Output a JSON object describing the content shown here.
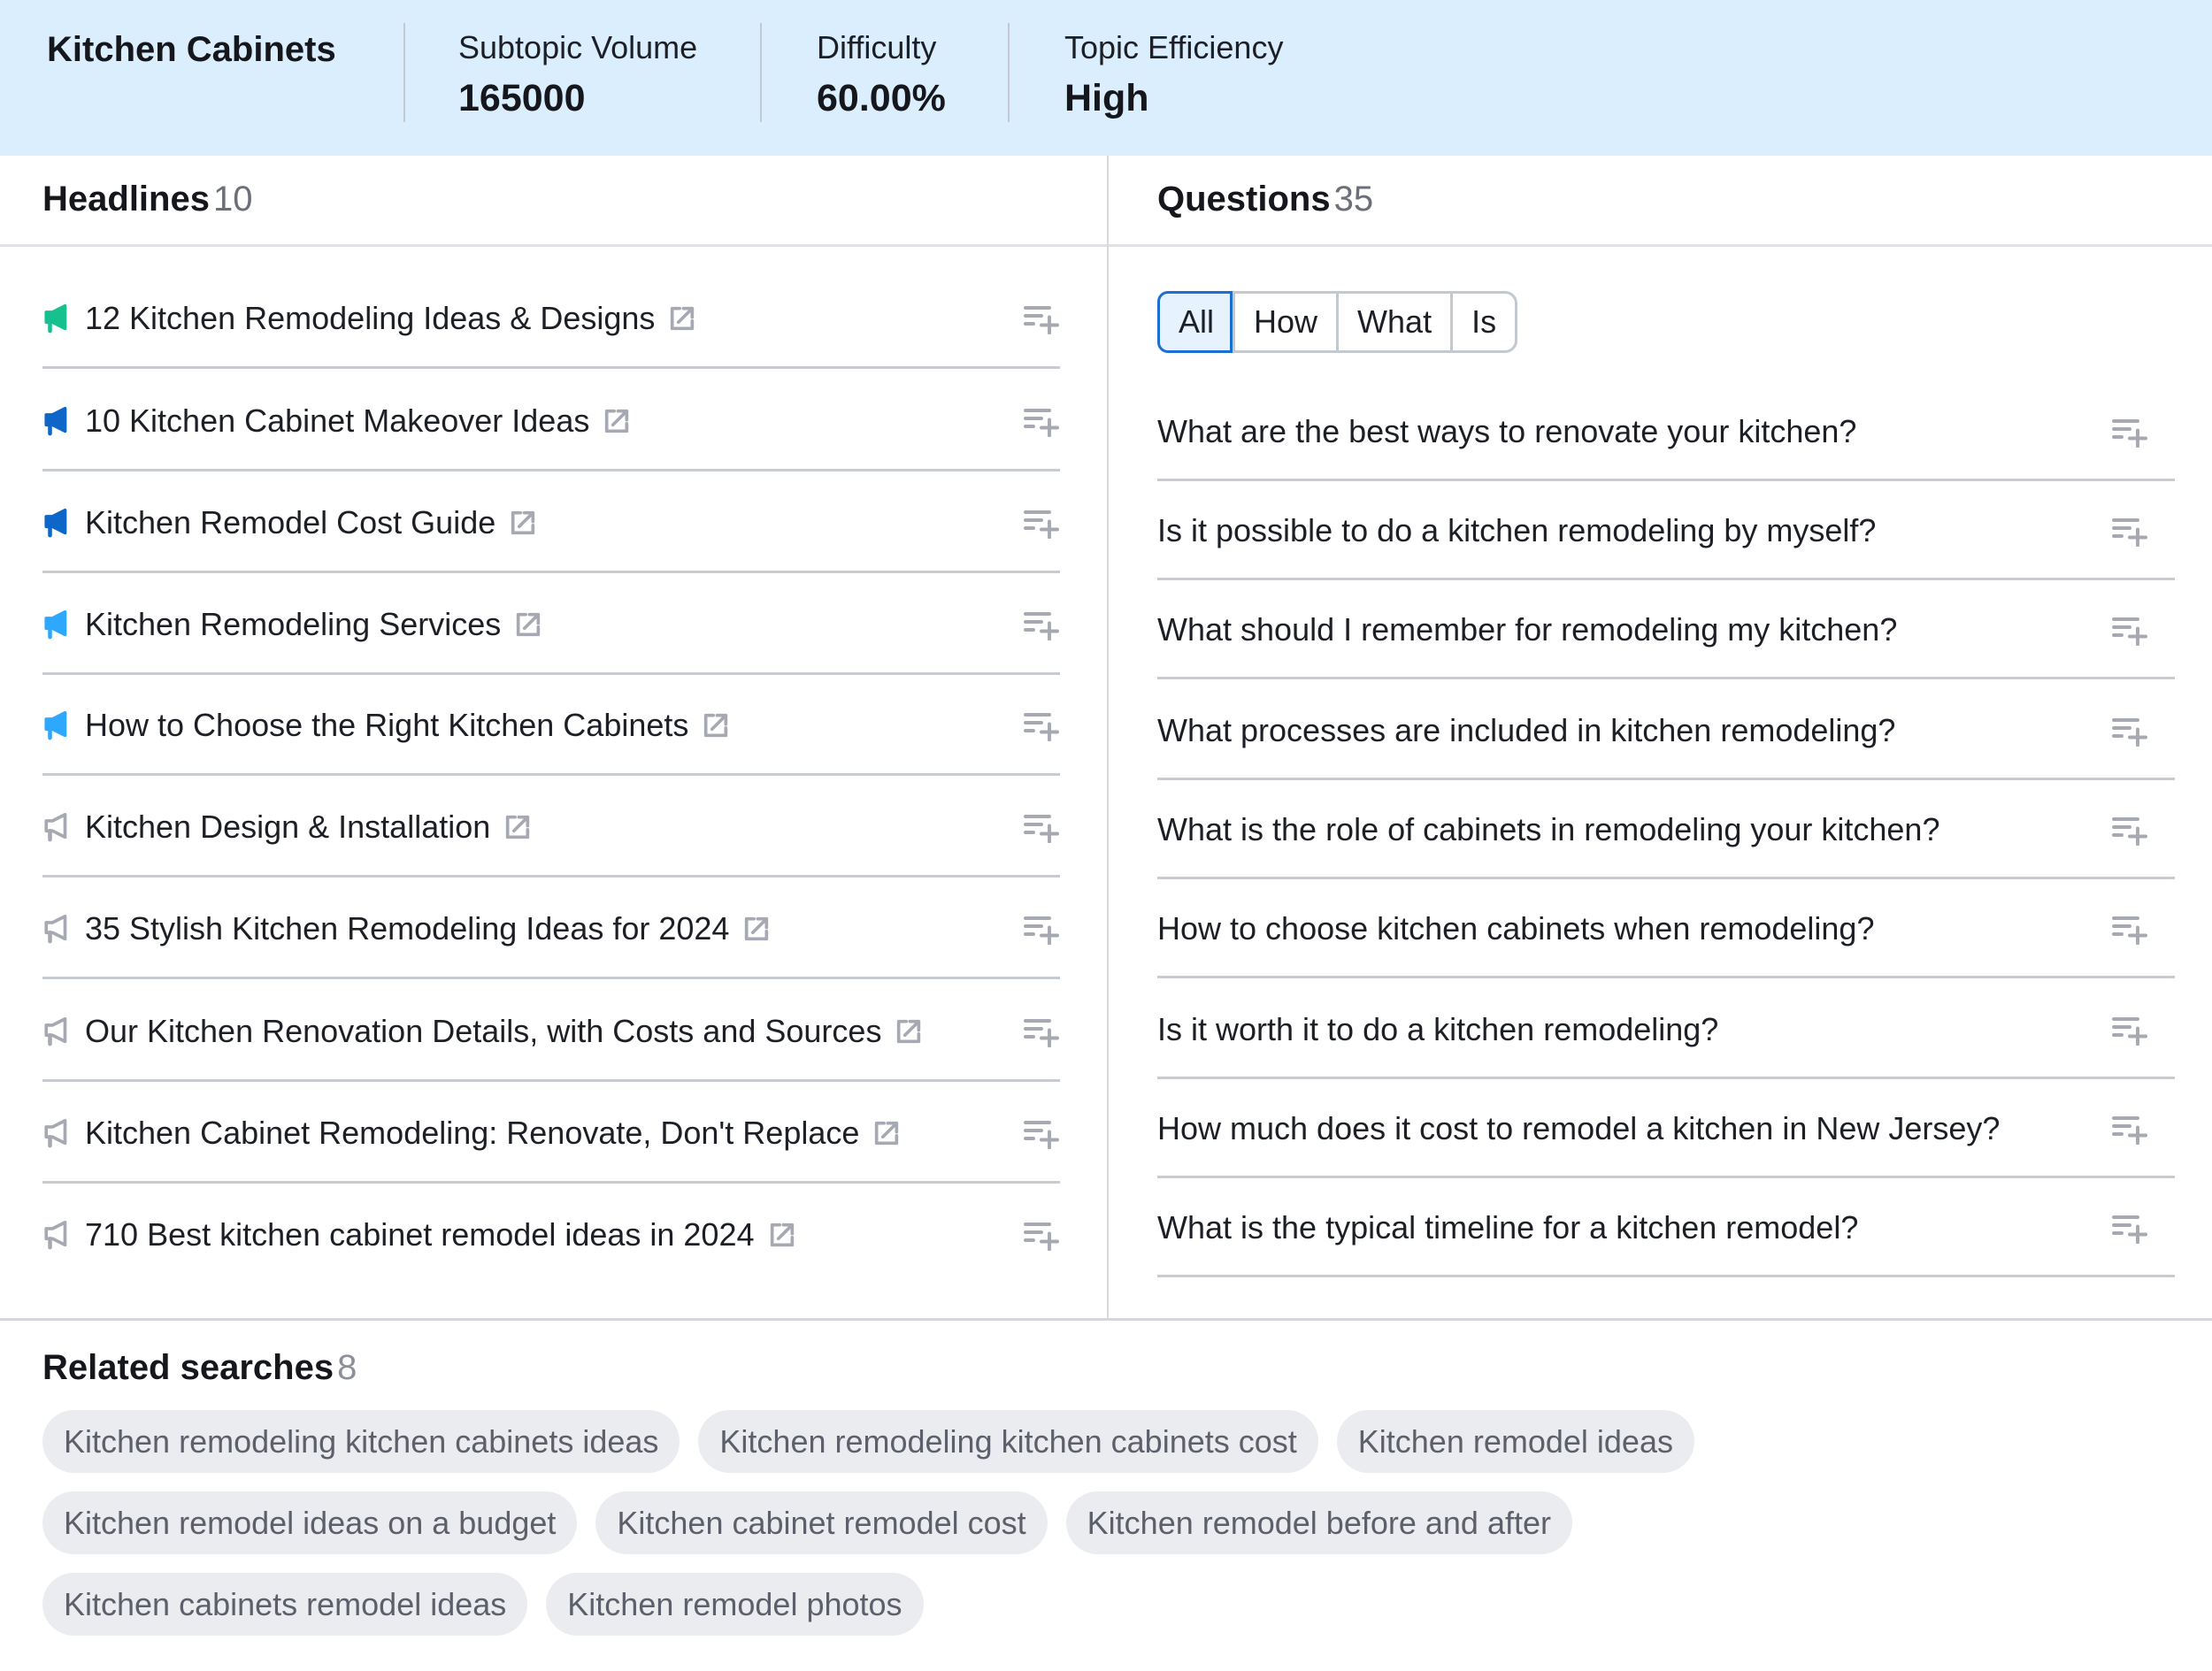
{
  "header": {
    "title": "Kitchen Cabinets",
    "metrics": [
      {
        "label": "Subtopic Volume",
        "value": "165000"
      },
      {
        "label": "Difficulty",
        "value": "60.00%"
      },
      {
        "label": "Topic Efficiency",
        "value": "High"
      }
    ]
  },
  "headlines": {
    "title": "Headlines",
    "count": "10",
    "items": [
      {
        "text": "12 Kitchen Remodeling Ideas & Designs",
        "icon": "megaphone-icon",
        "icon_color": "#17c08f",
        "icon_style": "filled"
      },
      {
        "text": "10 Kitchen Cabinet Makeover Ideas",
        "icon": "megaphone-icon",
        "icon_color": "#0f66c9",
        "icon_style": "filled"
      },
      {
        "text": "Kitchen Remodel Cost Guide",
        "icon": "megaphone-icon",
        "icon_color": "#0f66c9",
        "icon_style": "filled"
      },
      {
        "text": "Kitchen Remodeling Services",
        "icon": "megaphone-icon",
        "icon_color": "#2ea8ff",
        "icon_style": "filled"
      },
      {
        "text": "How to Choose the Right Kitchen Cabinets",
        "icon": "megaphone-icon",
        "icon_color": "#2ea8ff",
        "icon_style": "filled"
      },
      {
        "text": "Kitchen Design & Installation",
        "icon": "megaphone-icon",
        "icon_color": "#a6a9b2",
        "icon_style": "outline"
      },
      {
        "text": "35 Stylish Kitchen Remodeling Ideas for 2024",
        "icon": "megaphone-icon",
        "icon_color": "#a6a9b2",
        "icon_style": "outline"
      },
      {
        "text": "Our Kitchen Renovation Details, with Costs and Sources",
        "icon": "megaphone-icon",
        "icon_color": "#a6a9b2",
        "icon_style": "outline"
      },
      {
        "text": "Kitchen Cabinet Remodeling: Renovate, Don't Replace",
        "icon": "megaphone-icon",
        "icon_color": "#a6a9b2",
        "icon_style": "outline"
      },
      {
        "text": "710 Best kitchen cabinet remodel ideas in 2024",
        "icon": "megaphone-icon",
        "icon_color": "#a6a9b2",
        "icon_style": "outline"
      }
    ]
  },
  "questions": {
    "title": "Questions",
    "count": "35",
    "filters": [
      {
        "label": "All",
        "active": true
      },
      {
        "label": "How",
        "active": false
      },
      {
        "label": "What",
        "active": false
      },
      {
        "label": "Is",
        "active": false
      }
    ],
    "items": [
      "What are the best ways to renovate your kitchen?",
      "Is it possible to do a kitchen remodeling by myself?",
      "What should I remember for remodeling my kitchen?",
      "What processes are included in kitchen remodeling?",
      "What is the role of cabinets in remodeling your kitchen?",
      "How to choose kitchen cabinets when remodeling?",
      "Is it worth it to do a kitchen remodeling?",
      "How much does it cost to remodel a kitchen in New Jersey?",
      "What is the typical timeline for a kitchen remodel?"
    ]
  },
  "related": {
    "title": "Related searches",
    "count": "8",
    "rows": [
      [
        "Kitchen remodeling kitchen cabinets ideas",
        "Kitchen remodeling kitchen cabinets cost",
        "Kitchen remodel ideas"
      ],
      [
        "Kitchen remodel ideas on a budget",
        "Kitchen cabinet remodel cost",
        "Kitchen remodel before and after"
      ],
      [
        "Kitchen cabinets remodel ideas",
        "Kitchen remodel photos"
      ]
    ]
  },
  "colors": {
    "header_bg": "#dbeefe",
    "accent": "#1a6fd0",
    "chip_bg": "#ebecf0",
    "icon_gray": "#a6a9b2"
  }
}
